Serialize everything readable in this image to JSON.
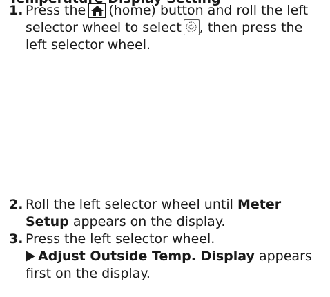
{
  "header_fragment": "Temperature Display Setting",
  "steps": [
    {
      "num": "1.",
      "text_a": "Press the",
      "text_b": "(home) button and roll the left",
      "text_c": "selector wheel to select",
      "text_d": ", then press the",
      "text_e": "left selector wheel."
    },
    {
      "num": "2.",
      "text_a": "Roll the left selector wheel until",
      "bold_a": "Meter",
      "bold_b": "Setup",
      "text_b": "appears on the display."
    },
    {
      "num": "3.",
      "text_a": "Press the left selector wheel.",
      "result_bold": "Adjust Outside Temp. Display",
      "result_text": "appears",
      "result_cont": "first on the display."
    }
  ],
  "icons": {
    "home": "home-icon",
    "settings": "gear-icon",
    "result": "triangle-arrow-icon"
  }
}
